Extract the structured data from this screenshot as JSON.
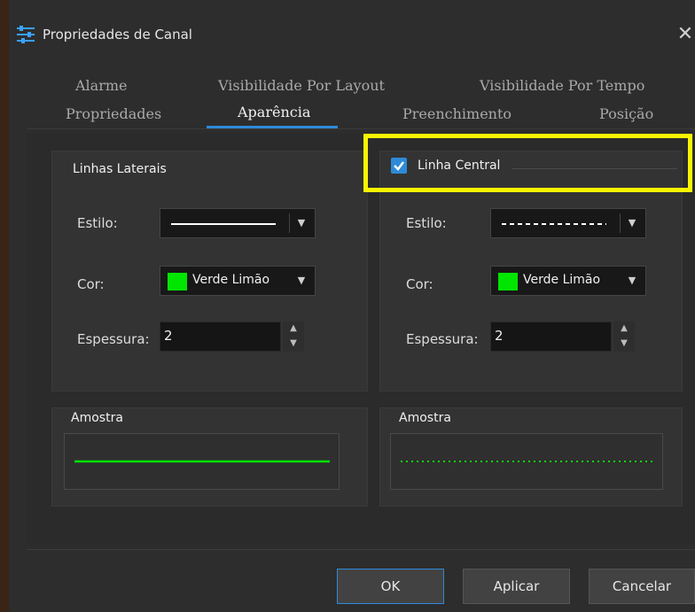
{
  "window": {
    "title": "Propriedades de Canal",
    "icon": "settings-sliders-icon",
    "close_icon": "close-icon",
    "close_glyph": "✕"
  },
  "tabs": {
    "row1": [
      {
        "label": "Alarme"
      },
      {
        "label": "Visibilidade Por Layout"
      },
      {
        "label": "Visibilidade Por Tempo"
      }
    ],
    "row2": [
      {
        "label": "Propriedades"
      },
      {
        "label": "Aparência",
        "active": true
      },
      {
        "label": "Preenchimento"
      },
      {
        "label": "Posição"
      }
    ]
  },
  "lateral": {
    "group_title": "Linhas Laterais",
    "style_label": "Estilo:",
    "style_value": "solid",
    "color_label": "Cor:",
    "color_value": "Verde Limão",
    "color_hex": "#00e600",
    "thickness_label": "Espessura:",
    "thickness_value": "2",
    "sample_label": "Amostra"
  },
  "central": {
    "enabled": true,
    "group_title": "Linha Central",
    "style_label": "Estilo:",
    "style_value": "dashed",
    "color_label": "Cor:",
    "color_value": "Verde Limão",
    "color_hex": "#00e600",
    "thickness_label": "Espessura:",
    "thickness_value": "2",
    "sample_label": "Amostra",
    "sample_style": "dotted"
  },
  "buttons": {
    "ok": "OK",
    "apply": "Aplicar",
    "cancel": "Cancelar"
  },
  "colors": {
    "accent": "#2e8ad8",
    "highlight": "#f8f500",
    "line_green": "#00e600"
  }
}
